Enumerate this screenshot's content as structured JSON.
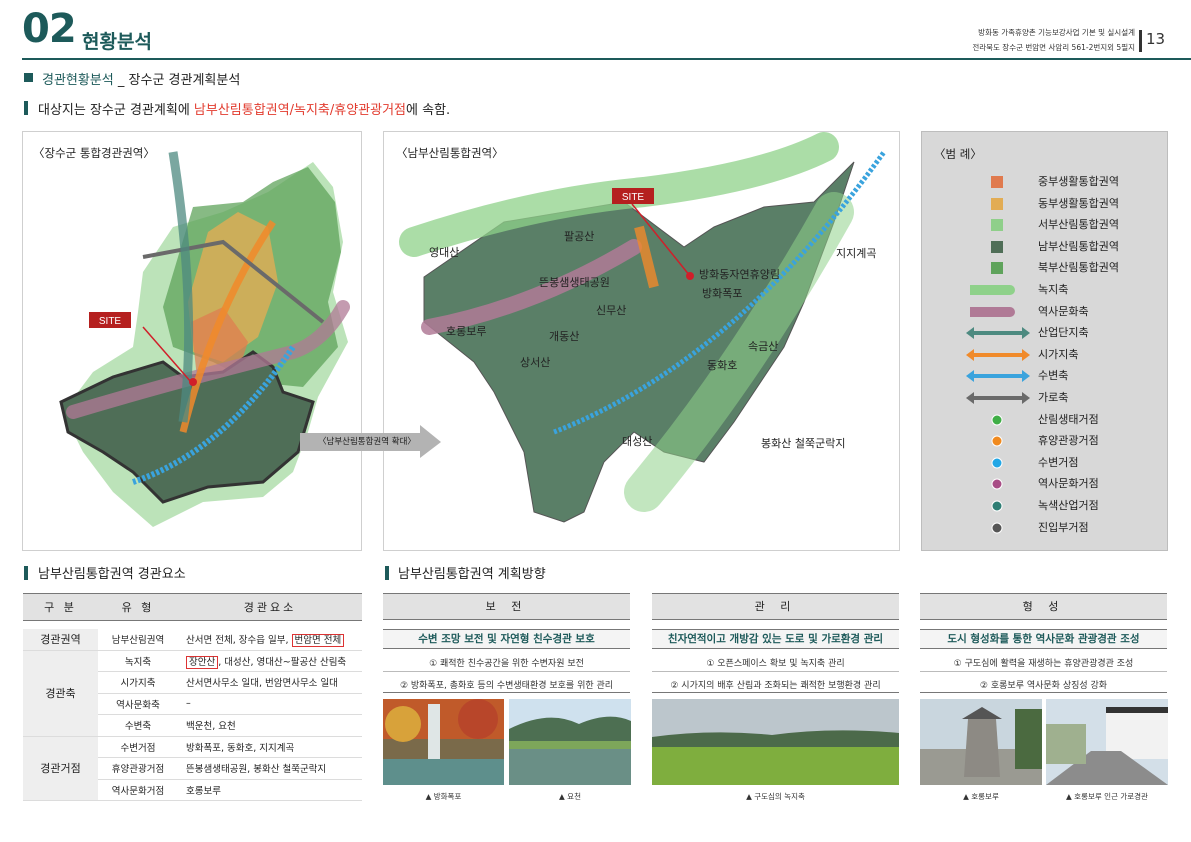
{
  "header": {
    "chapter_num": "02",
    "chapter_title": "현황분석",
    "meta_line1": "방화동 가족휴양촌 기능보강사업 기본 및 실시설계",
    "meta_line2": "전라북도 장수군 번암면 사암리 561-2번지외 5필지",
    "page_num": "13"
  },
  "section": {
    "title_part1": "경관현황분석",
    "title_sep": " _ ",
    "title_part2": "장수군 경관계획분석"
  },
  "intro": {
    "before": "대상지는 장수군 경관계획에 ",
    "highlight": "남부산림통합권역/녹지축/휴양관광거점",
    "after": "에 속함."
  },
  "map_left": {
    "caption": "〈장수군 통합경관권역〉",
    "site_label": "SITE"
  },
  "map_center": {
    "caption": "〈남부산림통합권역〉",
    "site_label": "SITE",
    "zoom_label": "〈남부산림통합권역 확대〉",
    "places": [
      "영대산",
      "팔공산",
      "뜬봉샘생태공원",
      "신무산",
      "방화동자연휴양림",
      "방화폭포",
      "지지계곡",
      "호롱보루",
      "개동산",
      "상서산",
      "속금산",
      "동화호",
      "대성산",
      "봉화산 철쭉군락지"
    ]
  },
  "legend": {
    "title": "〈범  례〉",
    "items": [
      {
        "label": "중부생활통합권역",
        "type": "square",
        "color": "#e07a4e"
      },
      {
        "label": "동부생활통합권역",
        "type": "square",
        "color": "#e2ac54"
      },
      {
        "label": "서부산림통합권역",
        "type": "square",
        "color": "#8fcf8a"
      },
      {
        "label": "남부산림통합권역",
        "type": "square",
        "color": "#4f6e57"
      },
      {
        "label": "북부산림통합권역",
        "type": "square",
        "color": "#5fa35b"
      },
      {
        "label": "녹지축",
        "type": "band",
        "color": "#8fd18a"
      },
      {
        "label": "역사문화축",
        "type": "band",
        "color": "#b07a96"
      },
      {
        "label": "산업단지축",
        "type": "arrow",
        "color": "#4d8a80"
      },
      {
        "label": "시가지축",
        "type": "arrow",
        "color": "#f08a2a"
      },
      {
        "label": "수변축",
        "type": "arrow",
        "color": "#3aa3dd"
      },
      {
        "label": "가로축",
        "type": "arrow",
        "color": "#6a6a6a"
      },
      {
        "label": "산림생태거점",
        "type": "dot",
        "color": "#3fae46"
      },
      {
        "label": "휴양관광거점",
        "type": "dot",
        "color": "#f08a1f"
      },
      {
        "label": "수변거점",
        "type": "dot",
        "color": "#22a7e6"
      },
      {
        "label": "역사문화거점",
        "type": "dot",
        "color": "#a84d86"
      },
      {
        "label": "녹색산업거점",
        "type": "dot",
        "color": "#2e7e74"
      },
      {
        "label": "진입부거점",
        "type": "dot",
        "color": "#555555"
      }
    ]
  },
  "elements": {
    "title": "남부산림통합권역 경관요소",
    "headers": [
      "구 분",
      "유 형",
      "경관요소"
    ],
    "rows": [
      {
        "group": "경관권역",
        "type": "남부산림권역",
        "value": "산서면 전체, 장수읍 일부, ",
        "boxed": "번암면 전체"
      },
      {
        "group": "경관축",
        "type": "녹지축",
        "boxed": "장안산",
        "value": ", 대성산, 영대산~팔공산 산림축"
      },
      {
        "group": "",
        "type": "시가지축",
        "value": "산서면사무소 일대, 번암면사무소 일대"
      },
      {
        "group": "",
        "type": "역사문화축",
        "value": "–"
      },
      {
        "group": "",
        "type": "수변축",
        "value": "백운천, 요천"
      },
      {
        "group": "경관거점",
        "type": "수변거점",
        "value": "방화폭포, 동화호, 지지계곡"
      },
      {
        "group": "",
        "type": "휴양관광거점",
        "value": "뜬봉샘생태공원, 봉화산 철쭉군락지"
      },
      {
        "group": "",
        "type": "역사문화거점",
        "value": "호롱보루"
      }
    ]
  },
  "directions": {
    "title": "남부산림통합권역 계획방향",
    "columns": [
      {
        "head": "보 전",
        "sub": "수변 조망 보전 및 자연형 친수경관 보호",
        "line1": "① 쾌적한 친수공간을 위한 수변자원 보전",
        "line2": "② 방화폭포, 총화호 등의 수변생태환경 보호를 위한 관리",
        "captions": [
          "▲ 방화폭포",
          "▲ 요천"
        ]
      },
      {
        "head": "관 리",
        "sub": "친자연적이고 개방감 있는 도로 및 가로환경 관리",
        "line1": "① 오픈스페이스 확보 및 녹지축 관리",
        "line2": "② 시가지의 배후 산림과 조화되는 쾌적한 보행환경 관리",
        "captions": [
          "▲ 구도심의 녹지축"
        ]
      },
      {
        "head": "형 성",
        "sub": "도시 형성화를 통한 역사문화 관광경관 조성",
        "line1": "① 구도심에 활력을 재생하는 휴양관광경관 조성",
        "line2": "② 호롱보루 역사문화 상징성 강화",
        "captions": [
          "▲ 호롱보루",
          "▲ 호롱보루 인근 가로경관"
        ]
      }
    ]
  }
}
